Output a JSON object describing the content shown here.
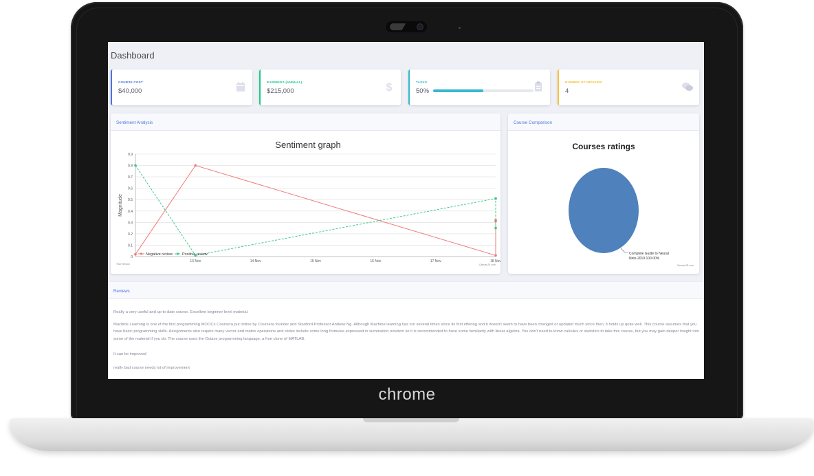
{
  "device": {
    "brand": "chrome"
  },
  "dashboard": {
    "title": "Dashboard",
    "cards": [
      {
        "label": "COURSE COST",
        "value": "$40,000",
        "accent": "#4e73df",
        "icon": "calendar-icon"
      },
      {
        "label": "EARNINGS (ANNUAL)",
        "value": "$215,000",
        "accent": "#1cc88a",
        "icon": "dollar-icon"
      },
      {
        "label": "TASKS",
        "value": "50%",
        "accent": "#36b9cc",
        "icon": "clipboard-icon",
        "progress": 0.5
      },
      {
        "label": "NUMBER OF REVIEWS",
        "value": "4",
        "accent": "#f6c23e",
        "icon": "comments-icon"
      }
    ],
    "sentiment_panel": {
      "title": "Sentiment Analysis"
    },
    "comparison_panel": {
      "title": "Course Comparison"
    },
    "reviews_panel": {
      "title": "Reviews",
      "items": [
        "Really a very useful and up to date course. Excellent beginner level material.",
        "Machine Learning is one of the first programming MOOCs Coursera put online by Coursera founder and Stanford Professor Andrew Ng. Although Machine learning has run several times since its first offering and it doesn't seem to have been changed or updated much since then, it holds up quite well. This course assumes that you have basic programming skills. Assignments also require many vector and matrix operations and slides include some long formulas expressed in summation notation so it is recommended to have some familiarity with linear algebra. You don't need to know calculus or statistics to take this course, but you may gain deeper insight into some of the material if you do. The course uses the Octave programming language, a free clone of MATLAB.",
        "It can be improved",
        "really bad course needs lot of improvement"
      ]
    }
  },
  "chart_data": [
    {
      "type": "line",
      "title": "Sentiment graph",
      "ylabel": "Magnitude",
      "xlabel": "",
      "ylim": [
        0,
        0.9
      ],
      "yticks": [
        "0",
        "0.1",
        "0.2",
        "0.3",
        "0.4",
        "0.5",
        "0.6",
        "0.7",
        "0.8",
        "0.9"
      ],
      "x_tick_labels": [
        "13 Nov",
        "14 Nov",
        "15 Nov",
        "16 Nov",
        "17 Nov",
        "18 Nov"
      ],
      "x_range": [
        "2019-11-12",
        "2019-11-18"
      ],
      "legend": "bottom-left",
      "grid": true,
      "footer_left": "Trial Version",
      "footer_right": "CanvasJS.com",
      "series": [
        {
          "name": "Negative review",
          "color": "#ee7b7b",
          "dash": false,
          "x": [
            "2019-11-12",
            "2019-11-13",
            "2019-11-18",
            "2019-11-18",
            "2019-11-18"
          ],
          "y": [
            0.02,
            0.8,
            0.01,
            0.31,
            0.32
          ]
        },
        {
          "name": "Positive review",
          "color": "#3cc98a",
          "dash": true,
          "x": [
            "2019-11-12",
            "2019-11-13",
            "2019-11-18",
            "2019-11-18",
            "2019-11-18"
          ],
          "y": [
            0.8,
            0.01,
            0.51,
            0.51,
            0.25
          ]
        }
      ]
    },
    {
      "type": "pie",
      "title": "Courses ratings",
      "footer_right": "CanvasJS.com",
      "slices": [
        {
          "label": "Complete Guide to Neural Nets-2019 100.00%",
          "value": 100,
          "color": "#4f81bd"
        }
      ]
    }
  ]
}
